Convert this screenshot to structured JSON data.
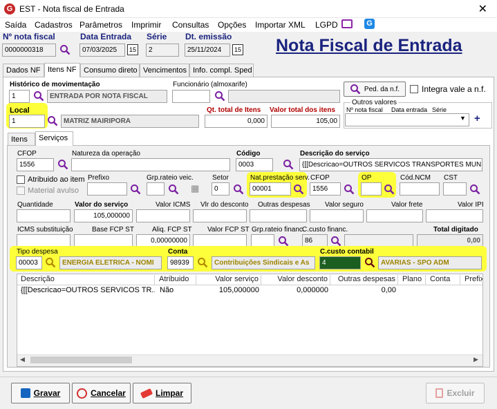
{
  "window": {
    "title": "EST - Nota fiscal de Entrada",
    "app_icon": "G"
  },
  "menu": [
    "Saída",
    "Cadastros",
    "Parâmetros",
    "Imprimir",
    "Consultas",
    "Opções",
    "Importar XML",
    "LGPD"
  ],
  "header": {
    "nota_label": "Nº nota fiscal",
    "nota_value": "0000000318",
    "data_label": "Data Entrada",
    "data_value": "07/03/2025",
    "serie_label": "Série",
    "serie_value": "2",
    "emissao_label": "Dt. emissão",
    "emissao_value": "25/11/2024",
    "page_title": "Nota Fiscal de Entrada"
  },
  "tabs": [
    "Dados NF",
    "Itens NF",
    "Consumo direto",
    "Vencimentos",
    "Info. compl. Sped"
  ],
  "form": {
    "historico_label": "Histórico de movimentação",
    "historico_code": "1",
    "historico_desc": "ENTRADA POR NOTA FISCAL",
    "funcionario_label": "Funcionário (almoxarife)",
    "ped_button": "Ped. da n.f.",
    "integra_label": "Integra vale a n.f.",
    "outros_label": "Outros valores",
    "outros_cols": [
      "Nº nota fiscal",
      "Data entrada",
      "Série"
    ],
    "local_label": "Local",
    "local_code": "1",
    "local_desc": "MATRIZ MAIRIPORA",
    "qt_label": "Qt. total de Itens",
    "qt_value": "0,000",
    "vt_label": "Valor total dos itens",
    "vt_value": "105,00"
  },
  "subtabs": [
    "Itens",
    "Serviços"
  ],
  "servico": {
    "cfop_label": "CFOP",
    "cfop_value": "1556",
    "natureza_label": "Natureza da operação",
    "codigo_label": "Código",
    "codigo_value": "0003",
    "desc_label": "Descrição do serviço",
    "desc_value": "{[[Descricao=OUTROS SERVICOS TRANSPORTES MUNICIPAIS",
    "atribuido_label": "Atribuido ao item",
    "material_label": "Material avulso",
    "prefixo_label": "Prefixo",
    "grprateio_label": "Grp.rateio veic.",
    "setor_label": "Setor",
    "setor_value": "0",
    "natprest_label": "Nat.prestação serv.",
    "natprest_value": "00001",
    "cfop2_label": "CFOP",
    "cfop2_value": "1556",
    "op_label": "OP",
    "codncm_label": "Cód.NCM",
    "cst_label": "CST",
    "quantidade_label": "Quantidade",
    "valorserv_label": "Valor do serviço",
    "valorserv_value": "105,000000",
    "valoricms_label": "Valor ICMS",
    "vlrdesc_label": "Vlr do desconto",
    "outras_label": "Outras despesas",
    "seguro_label": "Valor seguro",
    "frete_label": "Valor frete",
    "ipi_label": "Valor IPI",
    "icmssub_label": "ICMS substituição",
    "basefcp_label": "Base FCP ST",
    "aliqfcp_label": "Aliq. FCP ST",
    "aliqfcp_value": "0,00000000",
    "valorfcp_label": "Valor FCP ST",
    "grpfin_label": "Grp.rateio financ.",
    "ccfin_label": "C.custo financ.",
    "ccfin_value": "86",
    "total_label": "Total digitado",
    "total_value": "0,00",
    "tipo_label": "Tipo despesa",
    "tipo_code": "00003",
    "tipo_desc": "ENERGIA ELETRICA - NOMI",
    "conta_label": "Conta",
    "conta_code": "98939",
    "conta_desc": "Contribuições Sindicais e As",
    "ccont_label": "C.custo contabil",
    "ccont_code": "4",
    "ccont_desc": "AVARIAS - SPO ADM"
  },
  "grid": {
    "headers": [
      "Descrição",
      "Atribuido",
      "Valor serviço",
      "Valor desconto",
      "Outras despesas",
      "Plano",
      "Conta",
      "Prefix"
    ],
    "rows": [
      [
        "{[[Descricao=OUTROS SERVICOS TR...",
        "Não",
        "105,000000",
        "0,000000",
        "0,00",
        "",
        ""
      ]
    ]
  },
  "buttons": {
    "gravar": "Gravar",
    "cancelar": "Cancelar",
    "limpar": "Limpar",
    "excluir": "Excluir"
  },
  "colors": {
    "title_blue": "#1a237e",
    "highlight": "#fcff3a",
    "label_red": "#b00000"
  }
}
